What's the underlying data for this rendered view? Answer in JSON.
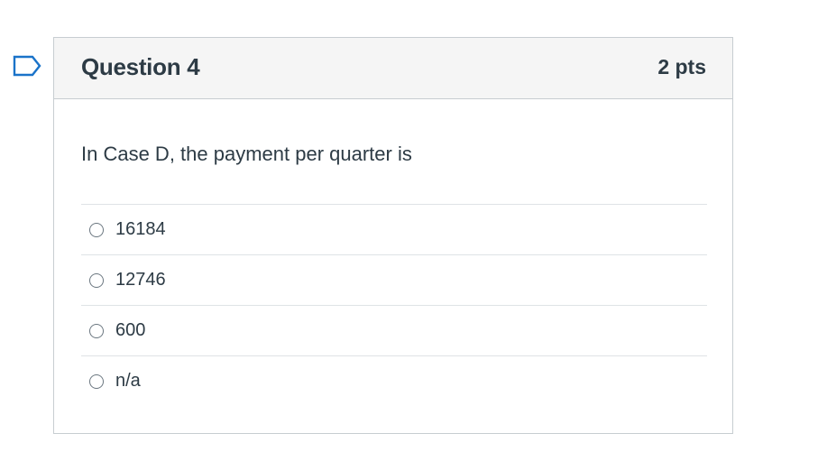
{
  "question": {
    "title": "Question 4",
    "points": "2 pts",
    "text": "In Case D, the payment per quarter is",
    "answers": [
      {
        "label": "16184"
      },
      {
        "label": "12746"
      },
      {
        "label": "600"
      },
      {
        "label": "n/a"
      }
    ]
  },
  "flag": {
    "icon": "bookmark-flag-icon",
    "color": "#1a73c9"
  },
  "colors": {
    "header_bg": "#f5f5f5",
    "border": "#c7cdd1",
    "text": "#2d3b45"
  }
}
